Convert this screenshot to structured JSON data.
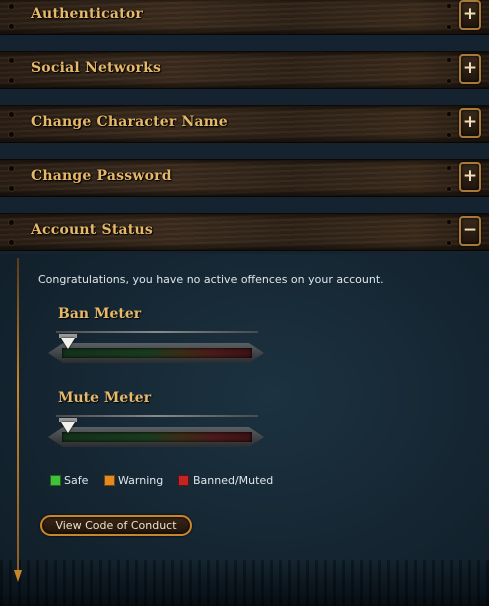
{
  "sections": [
    {
      "label": "Authenticator",
      "toggle": "+"
    },
    {
      "label": "Social Networks",
      "toggle": "+"
    },
    {
      "label": "Change Character Name",
      "toggle": "+"
    },
    {
      "label": "Change Password",
      "toggle": "+"
    },
    {
      "label": "Account Status",
      "toggle": "−"
    }
  ],
  "account_status": {
    "message": "Congratulations, you have no active offences on your account.",
    "ban_meter": {
      "title": "Ban Meter",
      "level": 0
    },
    "mute_meter": {
      "title": "Mute Meter",
      "level": 0
    },
    "legend": [
      {
        "label": "Safe",
        "color": "#3fc23a"
      },
      {
        "label": "Warning",
        "color": "#e48a1f"
      },
      {
        "label": "Banned/Muted",
        "color": "#c42424"
      }
    ],
    "conduct_button": "View Code of Conduct"
  },
  "colors": {
    "accent": "#e6b86a",
    "border": "#c8862b"
  }
}
